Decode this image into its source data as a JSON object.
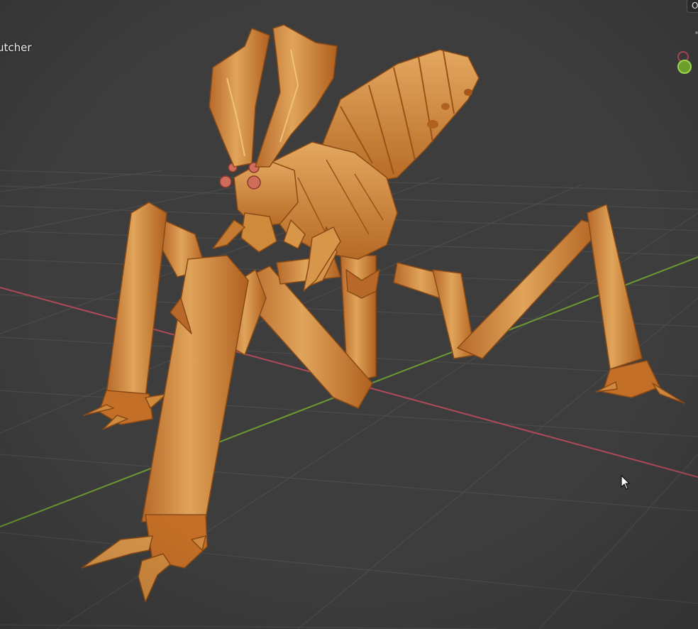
{
  "viewport": {
    "object_label": "utcher",
    "corner_button_label": "O"
  },
  "gizmo": {
    "x_axis_icon": "gizmo-x-axis-icon",
    "y_axis_icon": "gizmo-y-axis-icon"
  },
  "colors": {
    "background": "#3c3c3c",
    "grid": "#4a4a4a",
    "x_axis": "#b04a5a",
    "y_axis": "#6e9a32",
    "creature_base": "#d4913f",
    "creature_dark": "#a5571c",
    "creature_light": "#e8b06a",
    "eyes": "#d06c5a"
  },
  "cursor_icon": "mouse-cursor-icon"
}
